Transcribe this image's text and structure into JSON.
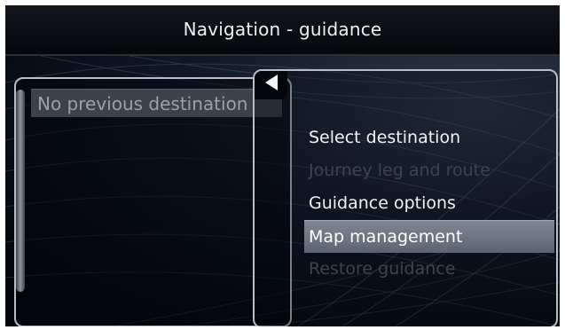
{
  "title": "Navigation - guidance",
  "back_icon": "triangle-left",
  "previous_destinations": {
    "items": [
      "No previous destination"
    ]
  },
  "menu": {
    "items": [
      {
        "label": "Select destination",
        "state": "enabled"
      },
      {
        "label": "Journey leg and route",
        "state": "disabled"
      },
      {
        "label": "Guidance options",
        "state": "enabled"
      },
      {
        "label": "Map management",
        "state": "selected"
      },
      {
        "label": "Restore guidance",
        "state": "disabled"
      }
    ]
  },
  "colors": {
    "background": "#03060c",
    "highlight": "#6e7783",
    "panel_border": "#b8bec6",
    "text_enabled": "#f1f3f5",
    "text_disabled": "#3e444c"
  }
}
